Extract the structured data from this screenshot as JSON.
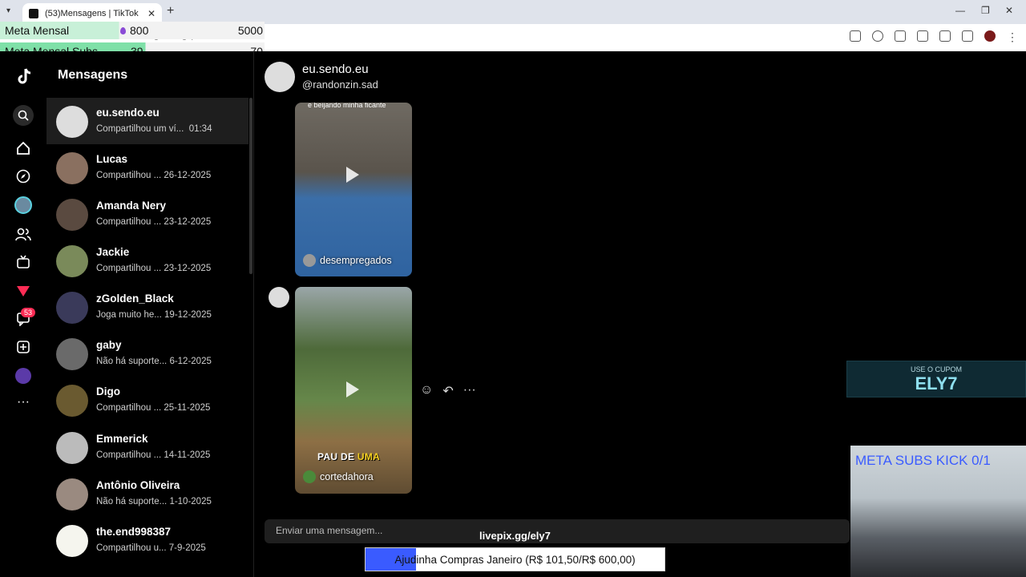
{
  "browser": {
    "tab_title": "(53)Mensagens | TikTok",
    "url": "tiktok.com/messages?lang=pt-BR"
  },
  "overlay": {
    "meta_mensal": {
      "label": "Meta Mensal",
      "value": "800",
      "goal": "5000"
    },
    "meta_subs": {
      "label": "Meta Mensal Subs",
      "value": "39",
      "goal": "70"
    },
    "coupon_top": "USE O CUPOM",
    "coupon_code": "ELY7",
    "cam_title": "META SUBS KICK 0/1",
    "livepix": "livepix.gg/ely7",
    "donation": {
      "text": "Ajudinha Compras Janeiro (R$ 101,50/R$ 600,00)",
      "progress": 0.169
    }
  },
  "sidebar": {
    "badge": "53",
    "title": "Mensagens"
  },
  "conversations": [
    {
      "name": "eu.sendo.eu",
      "preview": "Compartilhou um ví...",
      "time": "01:34"
    },
    {
      "name": "Lucas",
      "preview": "Compartilhou ...",
      "time": "26-12-2025"
    },
    {
      "name": "Amanda Nery",
      "preview": "Compartilhou ...",
      "time": "23-12-2025"
    },
    {
      "name": "Jackie",
      "preview": "Compartilhou ...",
      "time": "23-12-2025"
    },
    {
      "name": "zGolden_Black",
      "preview": "Joga muito he...",
      "time": "19-12-2025"
    },
    {
      "name": "gaby",
      "preview": "Não há suporte...",
      "time": "6-12-2025"
    },
    {
      "name": "Digo",
      "preview": "Compartilhou ...",
      "time": "25-11-2025"
    },
    {
      "name": "Emmerick",
      "preview": "Compartilhou ...",
      "time": "14-11-2025"
    },
    {
      "name": "Antônio Oliveira",
      "preview": "Não há suporte...",
      "time": "1-10-2025"
    },
    {
      "name": "the.end998387",
      "preview": "Compartilhou u...",
      "time": "7-9-2025"
    }
  ],
  "chat": {
    "name": "eu.sendo.eu",
    "handle": "@randonzin.sad",
    "video1": {
      "top_caption": "e beijando minha ficante",
      "account": "desempregados"
    },
    "video2": {
      "overlay_text_a": "PAU DE",
      "overlay_text_b": "UMA",
      "account": "cortedahora"
    },
    "input_placeholder": "Enviar uma mensagem..."
  }
}
